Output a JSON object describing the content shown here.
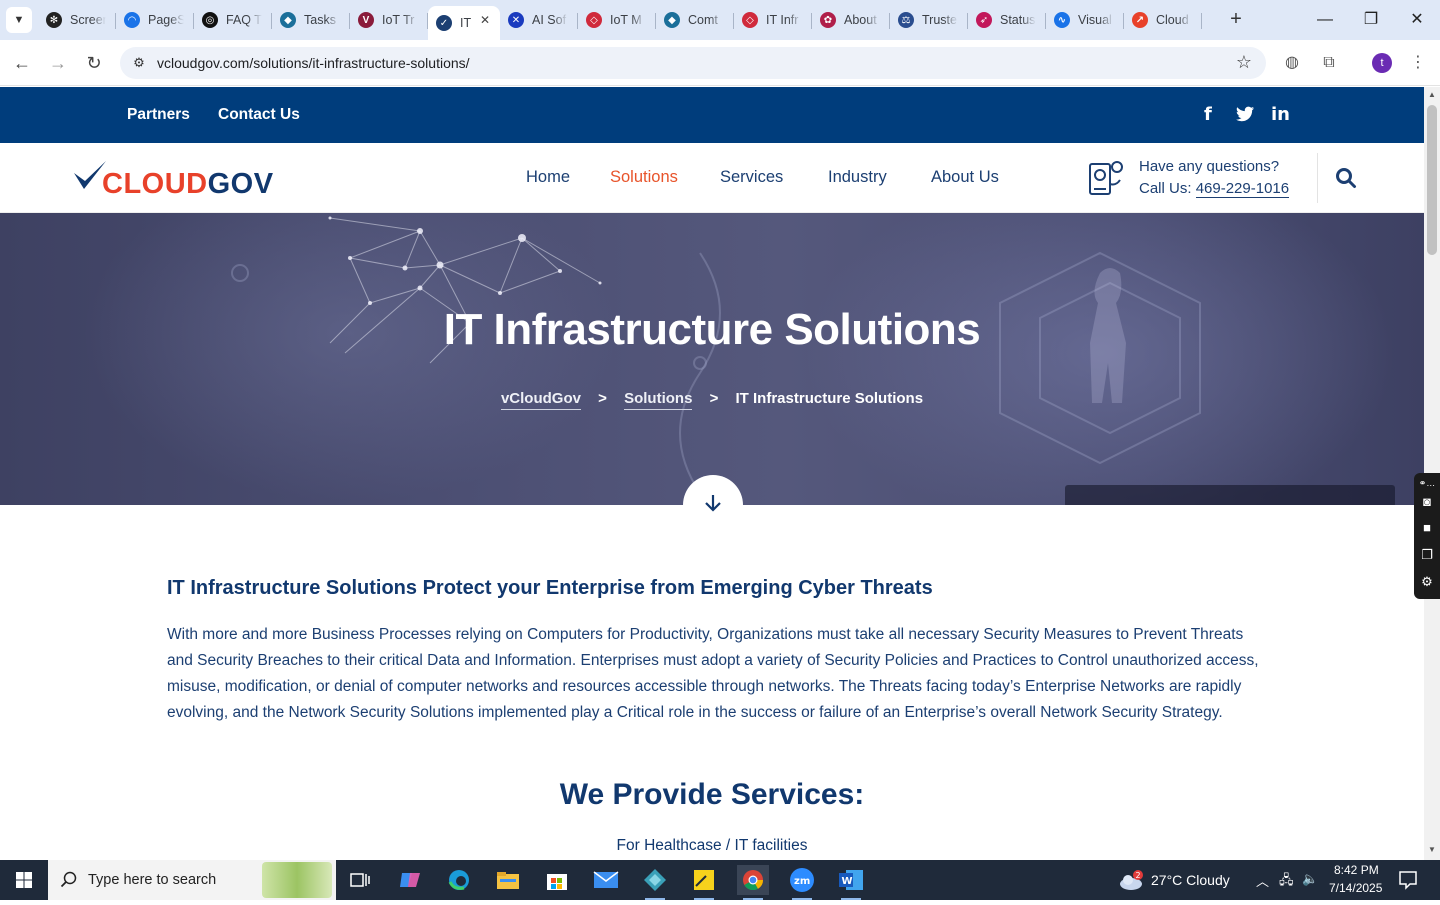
{
  "browser": {
    "tabs": [
      {
        "label": "Screen",
        "fav_color": "#222222",
        "fav_glyph": "✻"
      },
      {
        "label": "PageSpeed",
        "fav_color": "#1a73e8",
        "fav_glyph": "◠"
      },
      {
        "label": "FAQ T",
        "fav_color": "#111111",
        "fav_glyph": "◎"
      },
      {
        "label": "Tasks",
        "fav_color": "#1b6f9a",
        "fav_glyph": "◆"
      },
      {
        "label": "IoT Tr",
        "fav_color": "#8a1b3b",
        "fav_glyph": "V"
      },
      {
        "label": "IT",
        "fav_color": "#1c3f72",
        "fav_glyph": "✓",
        "active": true
      },
      {
        "label": "AI Sof",
        "fav_color": "#1a3bbf",
        "fav_glyph": "✕"
      },
      {
        "label": "IoT M",
        "fav_color": "#d02a3c",
        "fav_glyph": "◇"
      },
      {
        "label": "Comt",
        "fav_color": "#1b6f9a",
        "fav_glyph": "◆"
      },
      {
        "label": "IT Infr",
        "fav_color": "#d02a3c",
        "fav_glyph": "◇"
      },
      {
        "label": "About",
        "fav_color": "#b01f4a",
        "fav_glyph": "✿"
      },
      {
        "label": "Truste",
        "fav_color": "#2a4d8f",
        "fav_glyph": "⚖"
      },
      {
        "label": "Status",
        "fav_color": "#c2185b",
        "fav_glyph": "➶"
      },
      {
        "label": "Visual",
        "fav_color": "#1a73e8",
        "fav_glyph": "∿"
      },
      {
        "label": "Cloud",
        "fav_color": "#e8412a",
        "fav_glyph": "↗"
      }
    ],
    "url": "vcloudgov.com/solutions/it-infrastructure-solutions/",
    "profile_initial": "t"
  },
  "topbar": {
    "links": [
      "Partners",
      "Contact Us"
    ],
    "social": {
      "facebook": "f",
      "twitter": "🐦",
      "linkedin": "in"
    }
  },
  "header": {
    "logo": {
      "part1": "CLOUD",
      "part2": "GOV"
    },
    "nav": [
      {
        "label": "Home",
        "active": false
      },
      {
        "label": "Solutions",
        "active": true
      },
      {
        "label": "Services",
        "active": false
      },
      {
        "label": "Industry",
        "active": false
      },
      {
        "label": "About Us",
        "active": false
      }
    ],
    "questions": "Have any questions?",
    "call_prefix": "Call Us: ",
    "phone": "469-229-1016"
  },
  "hero": {
    "title": "IT Infrastructure Solutions",
    "breadcrumb": {
      "home": "vCloudGov",
      "section": "Solutions",
      "current": "IT Infrastructure Solutions",
      "separator": ">"
    }
  },
  "content": {
    "heading": "IT Infrastructure Solutions Protect your Enterprise from Emerging Cyber Threats",
    "paragraph": "With more and more Business Processes relying on Computers for Productivity, Organizations must take all necessary Security Measures to Prevent Threats and Security Breaches to their critical Data and Information. Enterprises must adopt a variety of Security Policies and Practices to Control unauthorized access, misuse, modification, or denial of computer networks and resources accessible through networks. The Threats facing today’s Enterprise Networks are rapidly evolving, and the Network Security Solutions implemented play a Critical role in the success or failure of an Enterprise’s overall Network Security Strategy.",
    "services_heading": "We Provide Services:",
    "services_sub": "For Healthcase / IT facilities"
  },
  "taskbar": {
    "search_placeholder": "Type here to search",
    "weather": "27°C  Cloudy",
    "weather_badge": "2",
    "time": "8:42 PM",
    "date": "7/14/2025"
  },
  "colors": {
    "brand_blue": "#003d7c",
    "brand_orange": "#e8542b",
    "text_navy": "#11386e"
  }
}
